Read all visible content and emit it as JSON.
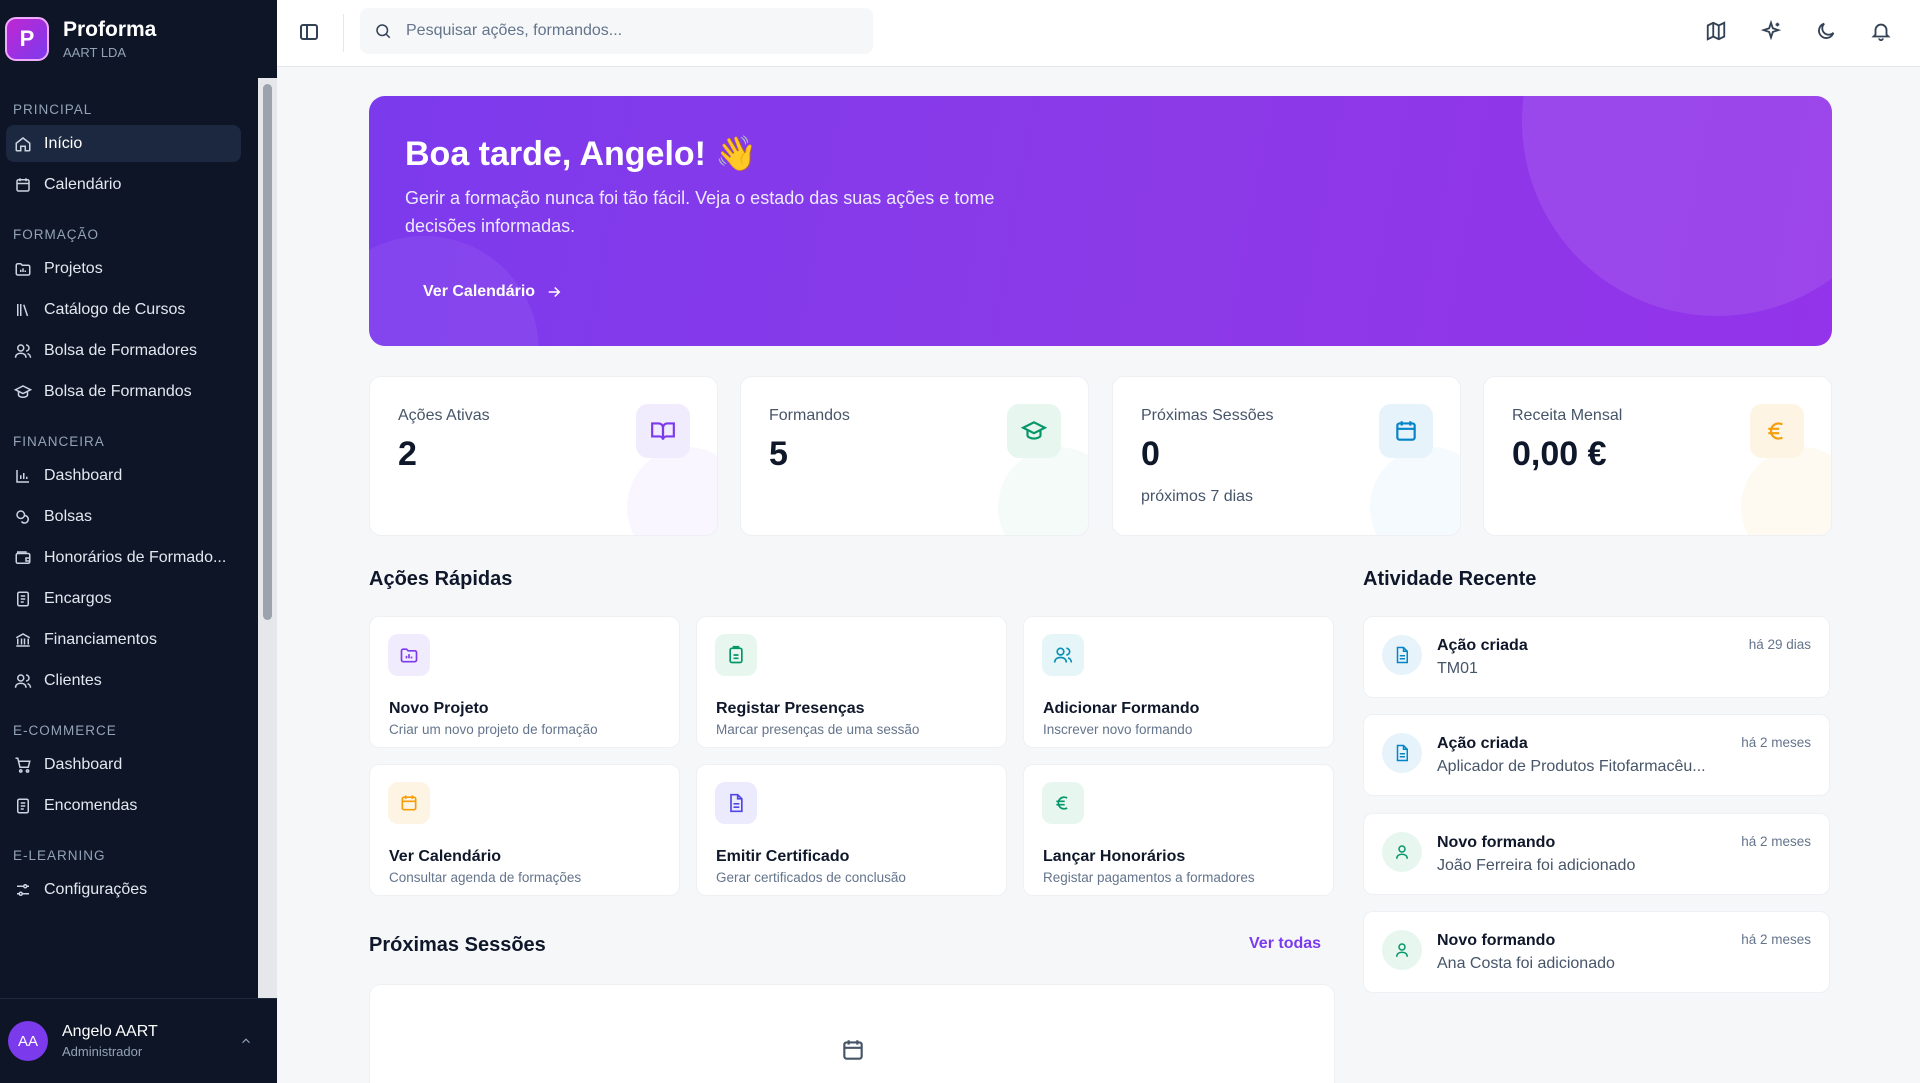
{
  "brand": {
    "logo_letter": "P",
    "title": "Proforma",
    "subtitle": "AART LDA"
  },
  "sidebar": {
    "sections": [
      {
        "label": "PRINCIPAL",
        "items": [
          {
            "label": "Início",
            "icon": "home-icon",
            "active": true
          },
          {
            "label": "Calendário",
            "icon": "calendar-icon"
          }
        ]
      },
      {
        "label": "FORMAÇÃO",
        "items": [
          {
            "label": "Projetos",
            "icon": "folder-chart-icon"
          },
          {
            "label": "Catálogo de Cursos",
            "icon": "library-icon"
          },
          {
            "label": "Bolsa de Formadores",
            "icon": "users-icon"
          },
          {
            "label": "Bolsa de Formandos",
            "icon": "graduation-cap-icon"
          }
        ]
      },
      {
        "label": "FINANCEIRA",
        "items": [
          {
            "label": "Dashboard",
            "icon": "bar-chart-icon"
          },
          {
            "label": "Bolsas",
            "icon": "coins-icon"
          },
          {
            "label": "Honorários de Formado...",
            "icon": "wallet-icon"
          },
          {
            "label": "Encargos",
            "icon": "receipt-icon"
          },
          {
            "label": "Financiamentos",
            "icon": "bank-icon"
          },
          {
            "label": "Clientes",
            "icon": "users-icon"
          }
        ]
      },
      {
        "label": "E-COMMERCE",
        "items": [
          {
            "label": "Dashboard",
            "icon": "cart-icon"
          },
          {
            "label": "Encomendas",
            "icon": "receipt-icon"
          }
        ]
      },
      {
        "label": "E-LEARNING",
        "items": [
          {
            "label": "Configurações",
            "icon": "sliders-icon"
          }
        ]
      }
    ]
  },
  "user": {
    "initials": "AA",
    "name": "Angelo AART",
    "role": "Administrador"
  },
  "search": {
    "placeholder": "Pesquisar ações, formandos..."
  },
  "hero": {
    "title": "Boa tarde, Angelo! 👋",
    "subtitle": "Gerir a formação nunca foi tão fácil. Veja o estado das suas ações e tome decisões informadas.",
    "button": "Ver Calendário"
  },
  "stats": [
    {
      "label": "Ações Ativas",
      "value": "2",
      "note": "",
      "icon": "book-open-icon",
      "color": "#7c3aed",
      "bg": "#f1ebfe"
    },
    {
      "label": "Formandos",
      "value": "5",
      "note": "",
      "icon": "graduation-cap-icon",
      "color": "#059669",
      "bg": "#e7f7f0"
    },
    {
      "label": "Próximas Sessões",
      "value": "0",
      "note": "próximos 7 dias",
      "icon": "calendar-icon",
      "color": "#0284c7",
      "bg": "#e6f3fb"
    },
    {
      "label": "Receita Mensal",
      "value": "0,00 €",
      "note": "",
      "icon": "euro-icon",
      "color": "#f59e0b",
      "bg": "#fdf4e3"
    }
  ],
  "quick_actions": {
    "heading": "Ações Rápidas",
    "items": [
      {
        "title": "Novo Projeto",
        "desc": "Criar um novo projeto de formação",
        "icon": "folder-chart-icon",
        "color": "#7c3aed",
        "bg": "#f1ebfe"
      },
      {
        "title": "Registar Presenças",
        "desc": "Marcar presenças de uma sessão",
        "icon": "clipboard-check-icon",
        "color": "#059669",
        "bg": "#e7f7f0"
      },
      {
        "title": "Adicionar Formando",
        "desc": "Inscrever novo formando",
        "icon": "users-icon",
        "color": "#0891b2",
        "bg": "#e6f5f8"
      },
      {
        "title": "Ver Calendário",
        "desc": "Consultar agenda de formações",
        "icon": "calendar-icon",
        "color": "#f59e0b",
        "bg": "#fdf4e3"
      },
      {
        "title": "Emitir Certificado",
        "desc": "Gerar certificados de conclusão",
        "icon": "file-text-icon",
        "color": "#4f46e5",
        "bg": "#ecebfd"
      },
      {
        "title": "Lançar Honorários",
        "desc": "Registar pagamentos a formadores",
        "icon": "euro-icon",
        "color": "#059669",
        "bg": "#e7f7f0"
      }
    ]
  },
  "activity": {
    "heading": "Atividade Recente",
    "items": [
      {
        "title": "Ação criada",
        "desc": "TM01",
        "time": "há 29 dias",
        "icon": "file-text-icon",
        "color": "#0284c7",
        "bg": "#e6f3fb"
      },
      {
        "title": "Ação criada",
        "desc": "Aplicador de Produtos Fitofarmacêu...",
        "time": "há 2 meses",
        "icon": "file-text-icon",
        "color": "#0284c7",
        "bg": "#e6f3fb"
      },
      {
        "title": "Novo formando",
        "desc": "João Ferreira foi adicionado",
        "time": "há 2 meses",
        "icon": "user-icon",
        "color": "#059669",
        "bg": "#e7f7f0"
      },
      {
        "title": "Novo formando",
        "desc": "Ana Costa foi adicionado",
        "time": "há 2 meses",
        "icon": "user-icon",
        "color": "#059669",
        "bg": "#e7f7f0"
      }
    ]
  },
  "sessions": {
    "heading": "Próximas Sessões",
    "see_all": "Ver todas"
  }
}
